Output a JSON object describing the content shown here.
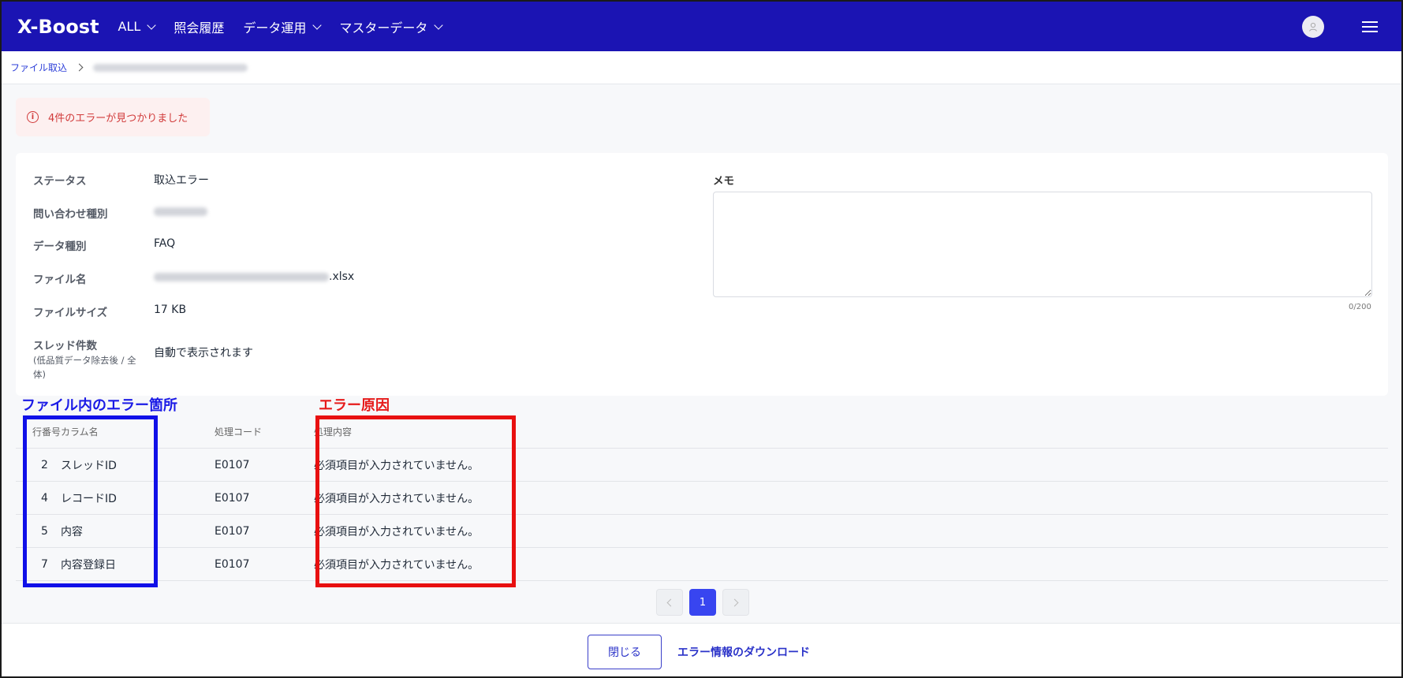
{
  "nav": {
    "logo": "X-Boost",
    "items": [
      {
        "label": "ALL",
        "dropdown": true
      },
      {
        "label": "照会履歴",
        "dropdown": false
      },
      {
        "label": "データ運用",
        "dropdown": true
      },
      {
        "label": "マスターデータ",
        "dropdown": true
      }
    ]
  },
  "breadcrumb": {
    "parent": "ファイル取込"
  },
  "alert": {
    "icon": "info-icon",
    "glyph": "i",
    "message": "4件のエラーが見つかりました",
    "color": "#d13a3a"
  },
  "info": {
    "status_label": "ステータス",
    "status_value": "取込エラー",
    "inquiry_label": "問い合わせ種別",
    "datatype_label": "データ種別",
    "datatype_value": "FAQ",
    "filename_label": "ファイル名",
    "filename_ext": ".xlsx",
    "filesize_label": "ファイルサイズ",
    "filesize_value": "17 KB",
    "thread_label": "スレッド件数",
    "thread_sub": "(低品質データ除去後 / 全体)",
    "thread_value": "自動で表示されます"
  },
  "memo": {
    "label": "メモ",
    "count": "0/200"
  },
  "annotations": {
    "blue_label": "ファイル内のエラー箇所",
    "red_label": "エラー原因",
    "blue_color": "#1010e8",
    "red_color": "#e81010"
  },
  "table": {
    "headers": {
      "no": "行番号",
      "column": "カラム名",
      "code": "処理コード",
      "message": "処理内容"
    },
    "rows": [
      {
        "no": "2",
        "column": "スレッドID",
        "code": "E0107",
        "message": "必須項目が入力されていません。"
      },
      {
        "no": "4",
        "column": "レコードID",
        "code": "E0107",
        "message": "必須項目が入力されていません。"
      },
      {
        "no": "5",
        "column": "内容",
        "code": "E0107",
        "message": "必須項目が入力されていません。"
      },
      {
        "no": "7",
        "column": "内容登録日",
        "code": "E0107",
        "message": "必須項目が入力されていません。"
      }
    ]
  },
  "pagination": {
    "current": "1"
  },
  "footer": {
    "close_label": "閉じる",
    "download_label": "エラー情報のダウンロード"
  },
  "colors": {
    "brand": "#1b14b3",
    "accent": "#3845f0"
  }
}
